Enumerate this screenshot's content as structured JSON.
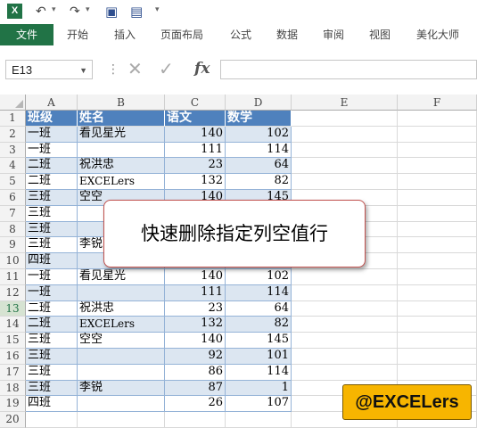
{
  "qat": {
    "app_icon": "X",
    "undo_icon": "undo-icon",
    "redo_icon": "redo-icon",
    "save_icon": "save-icon"
  },
  "ribbon": {
    "file_tab": "文件",
    "tabs": [
      "开始",
      "插入",
      "页面布局",
      "公式",
      "数据",
      "审阅",
      "视图",
      "美化大师"
    ]
  },
  "formula_bar": {
    "name_box": "E13",
    "cancel": "✕",
    "enter": "✓",
    "fx": "fx",
    "value": ""
  },
  "columns": [
    "A",
    "B",
    "C",
    "D",
    "E",
    "F"
  ],
  "rows": [
    "1",
    "2",
    "3",
    "4",
    "5",
    "6",
    "7",
    "8",
    "9",
    "10",
    "11",
    "12",
    "13",
    "14",
    "15",
    "16",
    "17",
    "18",
    "19",
    "20"
  ],
  "selected_row": "13",
  "table": {
    "headers": [
      "班级",
      "姓名",
      "语文",
      "数学"
    ],
    "rows": [
      [
        "一班",
        "看见星光",
        "140",
        "102"
      ],
      [
        "一班",
        "",
        "111",
        "114"
      ],
      [
        "二班",
        "祝洪忠",
        "23",
        "64"
      ],
      [
        "二班",
        "EXCELers",
        "132",
        "82"
      ],
      [
        "三班",
        "空空",
        "140",
        "145"
      ],
      [
        "三班",
        "",
        "",
        ""
      ],
      [
        "三班",
        "",
        "",
        ""
      ],
      [
        "三班",
        "李锐",
        "",
        ""
      ],
      [
        "四班",
        "",
        "",
        ""
      ],
      [
        "一班",
        "看见星光",
        "140",
        "102"
      ],
      [
        "一班",
        "",
        "111",
        "114"
      ],
      [
        "二班",
        "祝洪忠",
        "23",
        "64"
      ],
      [
        "二班",
        "EXCELers",
        "132",
        "82"
      ],
      [
        "三班",
        "空空",
        "140",
        "145"
      ],
      [
        "三班",
        "",
        "92",
        "101"
      ],
      [
        "三班",
        "",
        "86",
        "114"
      ],
      [
        "三班",
        "李锐",
        "87",
        "1"
      ],
      [
        "四班",
        "",
        "26",
        "107"
      ]
    ]
  },
  "callout": "快速删除指定列空值行",
  "badge": "@EXCELers",
  "colors": {
    "accent": "#217346",
    "table_header": "#4f81bd",
    "band": "#dce6f1",
    "badge": "#f7b500",
    "callout_border": "#c0504d"
  }
}
